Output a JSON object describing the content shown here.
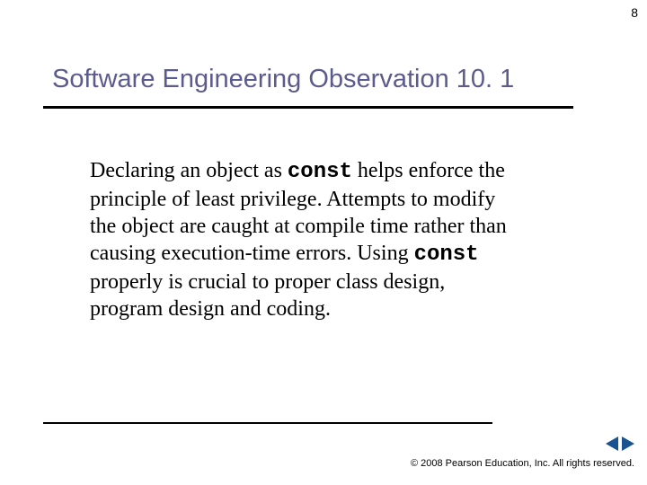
{
  "page_number": "8",
  "title": "Software Engineering Observation 10. 1",
  "body": {
    "seg1": "Declaring an object as ",
    "const1": "const",
    "seg2": " helps enforce the principle of least privilege. Attempts to modify the object are caught at compile time rather than causing execution-time errors. Using ",
    "const2": "const",
    "seg3": " properly is crucial to proper class design, program design and coding."
  },
  "footer": "© 2008 Pearson Education, Inc. All rights reserved."
}
